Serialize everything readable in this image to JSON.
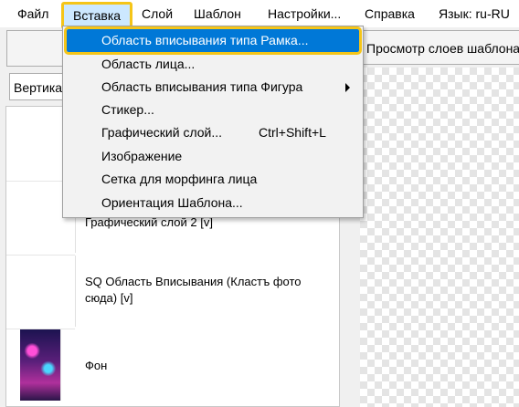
{
  "menubar": {
    "items": [
      {
        "label": "Файл"
      },
      {
        "label": "Вставка"
      },
      {
        "label": "Слой"
      },
      {
        "label": "Шаблон"
      },
      {
        "label": "Настройки..."
      },
      {
        "label": "Справка"
      },
      {
        "label": "Язык: ru-RU"
      }
    ]
  },
  "toolbar": {
    "preview_label": "Просмотр слоев шаблона",
    "orientation_label": "Вертикальная"
  },
  "layers": [
    {
      "label": ""
    },
    {
      "label": "Графический слой 2 [v]"
    },
    {
      "label": "SQ Область Вписывания (Кластъ фото сюда) [v]"
    },
    {
      "label": "Фон"
    }
  ],
  "insert_menu": {
    "items": [
      {
        "label": "Область вписывания типа Рамка...",
        "shortcut": "",
        "submenu": false
      },
      {
        "label": "Область лица...",
        "shortcut": "",
        "submenu": false
      },
      {
        "label": "Область вписывания типа Фигура",
        "shortcut": "",
        "submenu": true
      },
      {
        "label": "Стикер...",
        "shortcut": "",
        "submenu": false
      },
      {
        "label": "Графический слой...",
        "shortcut": "Ctrl+Shift+L",
        "submenu": false
      },
      {
        "label": "Изображение",
        "shortcut": "",
        "submenu": false
      },
      {
        "label": "Сетка для морфинга лица",
        "shortcut": "",
        "submenu": false
      },
      {
        "label": "Ориентация Шаблона...",
        "shortcut": "",
        "submenu": false
      }
    ]
  },
  "colors": {
    "highlight": "#0078d7",
    "focus_ring": "#f5c518",
    "menu_active_bg": "#cce8ff"
  }
}
